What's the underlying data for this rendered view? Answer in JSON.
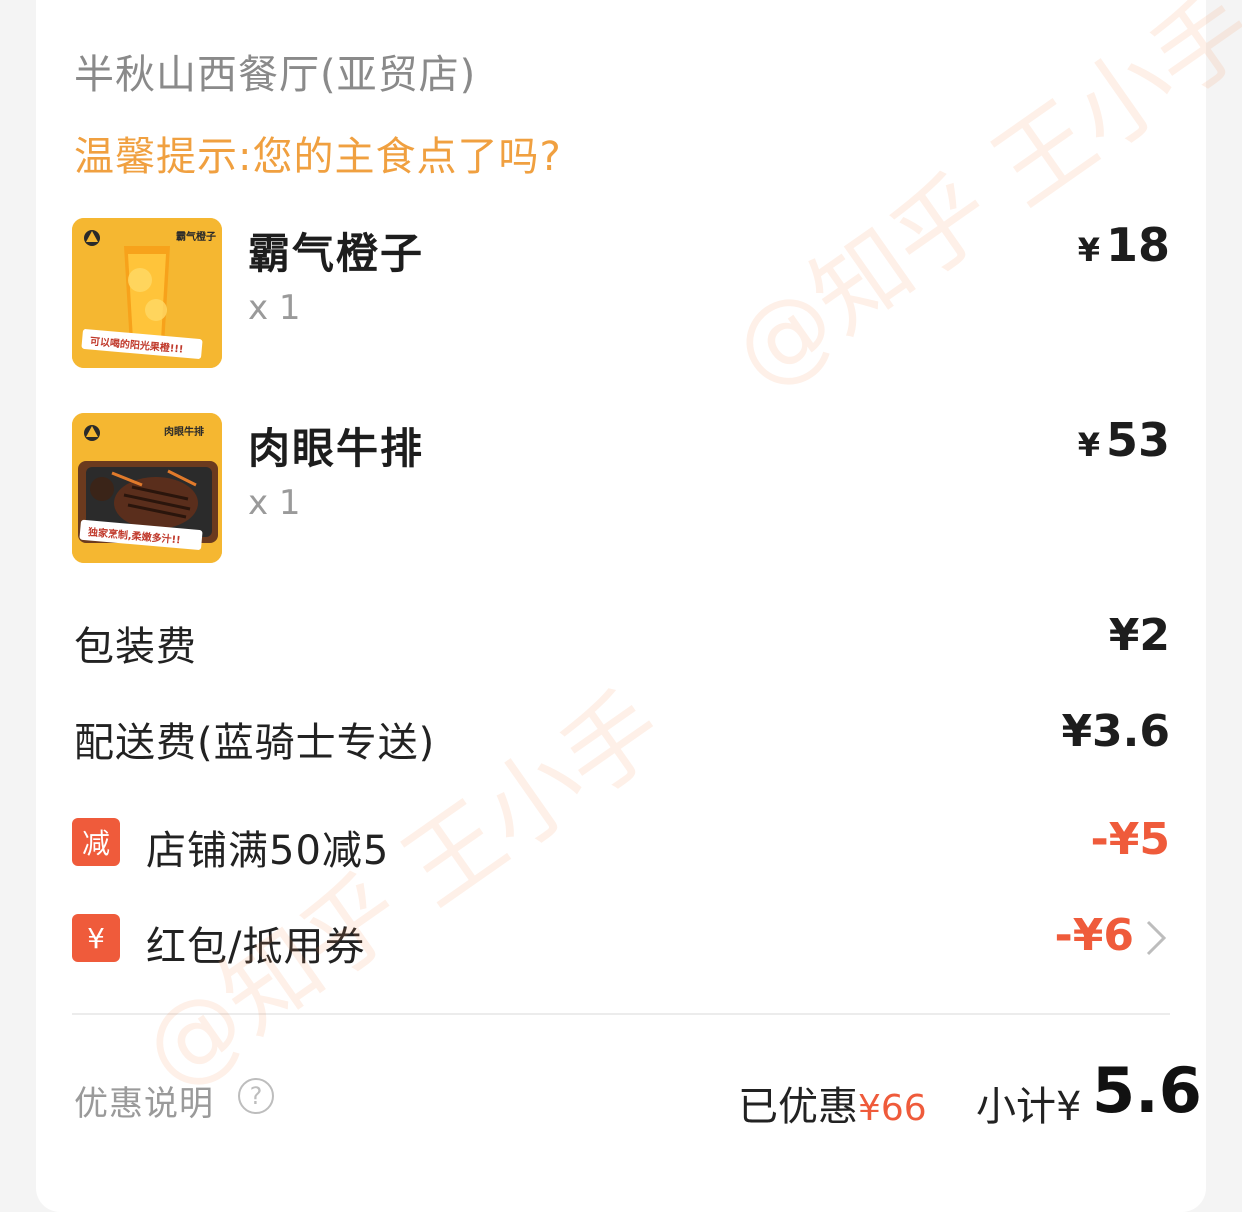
{
  "shop": {
    "name": "半秋山西餐厅(亚贸店)"
  },
  "tip": "温馨提示:您的主食点了吗?",
  "items": [
    {
      "name": "霸气橙子",
      "qty": "x 1",
      "currency": "¥",
      "price": "18",
      "thumb_brand": "霸气橙子",
      "thumb_caption": "可以喝的阳光果橙!!!"
    },
    {
      "name": "肉眼牛排",
      "qty": "x 1",
      "currency": "¥",
      "price": "53",
      "thumb_brand": "肉眼牛排",
      "thumb_caption": "独家烹制,柔嫩多汁!!"
    }
  ],
  "fees": [
    {
      "label": "包装费",
      "value": "¥2"
    },
    {
      "label": "配送费(蓝骑士专送)",
      "value": "¥3.6"
    }
  ],
  "discounts": [
    {
      "badge": "减",
      "label": "店铺满50减5",
      "value": "-¥5"
    },
    {
      "badge": "¥",
      "label": "红包/抵用券",
      "value": "-¥6"
    }
  ],
  "footer": {
    "explain_label": "优惠说明",
    "help_glyph": "?",
    "saved_label": "已优惠",
    "saved_amount": "¥66",
    "subtotal_label": "小计¥",
    "subtotal_amount": "5.6"
  },
  "watermark": "@知乎 王小手",
  "colors": {
    "accent_orange": "#f0a040",
    "discount_red": "#ef5b3b",
    "thumb_yellow": "#f5b731"
  }
}
